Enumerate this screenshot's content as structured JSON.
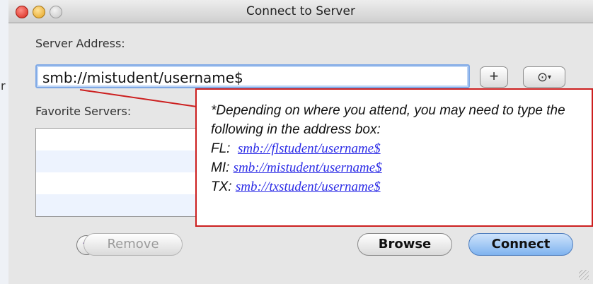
{
  "background": {
    "fragment": "r"
  },
  "window": {
    "title": "Connect to Server",
    "server_address_label": "Server Address:",
    "address_value": "smb://mistudent/username$",
    "add_button": "+",
    "action_icon": "gear-dropdown-icon",
    "favorites_label": "Favorite Servers:",
    "favorites": [
      "",
      "",
      "",
      ""
    ],
    "help_label": "?",
    "remove_label": "Remove",
    "browse_label": "Browse",
    "connect_label": "Connect"
  },
  "callout": {
    "note": "*Depending on where you attend, you may need to type the following in the address box:",
    "entries": [
      {
        "prefix": "FL:",
        "link": "smb://flstudent/username$"
      },
      {
        "prefix": "MI:",
        "link": "smb://mistudent/username$"
      },
      {
        "prefix": "TX:",
        "link": "smb://txstudent/username$"
      }
    ]
  },
  "colors": {
    "callout_border": "#cc1f1f",
    "link": "#2b2be6",
    "focus_ring": "#7fa9e6"
  }
}
